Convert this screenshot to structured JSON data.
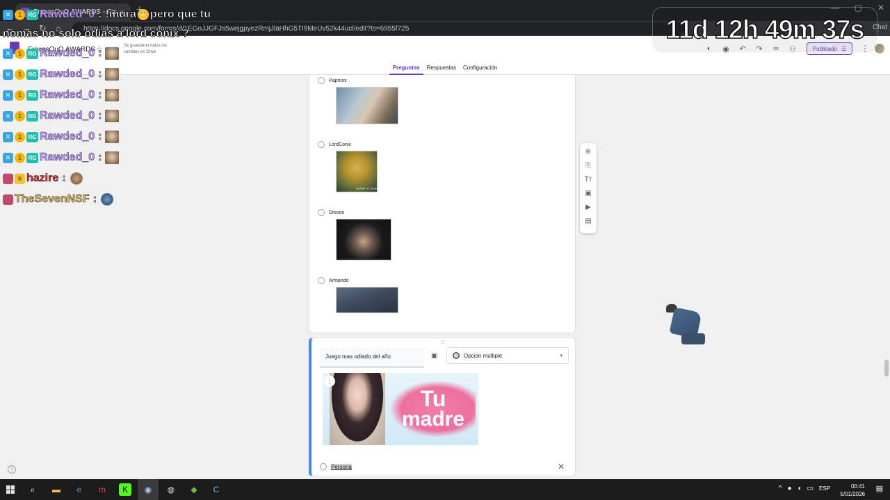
{
  "browser": {
    "tab_title": "FracasOuO AWARDS - Formularios",
    "tab_close": "×",
    "new_tab": "+",
    "url": "https://docs.google.com/forms/d/1EGoJJGFJs5wejgpyezRmjJlaHhG5TI9MeUv52k44ucl/edit?ts=6955f725",
    "chat_label": "Chat",
    "nav": {
      "back": "←",
      "forward": "→",
      "reload": "↻",
      "home": "⌂"
    },
    "window_controls": {
      "minimize": "—",
      "maximize": "▢",
      "close": "✕"
    }
  },
  "forms_header": {
    "doc_title": "FracasOuO AWARDS",
    "save_status": "Se guardaron todos los cambios en Drive",
    "publish_label": "Publicado",
    "icons": [
      "palette-icon",
      "preview-eye-icon",
      "undo-icon",
      "redo-icon",
      "link-icon",
      "add-collaborator-icon"
    ],
    "tabs": [
      {
        "label": "Preguntas",
        "active": true
      },
      {
        "label": "Respuestas",
        "active": false
      },
      {
        "label": "Configuración",
        "active": false
      }
    ]
  },
  "options": [
    {
      "label": "Papruxx"
    },
    {
      "label": "LordConix",
      "image_caption": "AGOST 17 •3:38"
    },
    {
      "label": "Drevox"
    },
    {
      "label": "Armando"
    }
  ],
  "question": {
    "title": "Juego mas odiado del año",
    "type_label": "Opción múltiple",
    "type_arrow": "▾",
    "image_line1": "Tu",
    "image_line2": "madre",
    "answer": "Persona",
    "remove": "✕",
    "image_menu": "⋮",
    "drag_handle": "⠿"
  },
  "side_toolbar": {
    "icons": [
      "add-question-icon",
      "import-questions-icon",
      "add-title-icon",
      "add-image-icon",
      "add-video-icon",
      "add-section-icon"
    ],
    "glyphs": [
      "⊕",
      "⎘",
      "Tт",
      "▣",
      "▶",
      "▤"
    ]
  },
  "stream_overlay": {
    "chat": [
      {
        "user": "Rawded_0",
        "message": "!mura",
        "message_tail": "pero que tu",
        "continuation": "nomas no solo odias a lord conix ?",
        "emote": "face-emote"
      },
      {
        "user": "Rawded_0",
        "message": "",
        "emote": "dog-emote"
      },
      {
        "user": "Rawded_0",
        "message": "",
        "emote": "dog-emote"
      },
      {
        "user": "Rawded_0",
        "message": "",
        "emote": "dog-emote"
      },
      {
        "user": "Rawded_0",
        "message": "",
        "emote": "dog-emote"
      },
      {
        "user": "Rawded_0",
        "message": "",
        "emote": "dog-emote"
      },
      {
        "user": "Rawded_0",
        "message": "",
        "emote": "dog-emote"
      },
      {
        "user": "hazire",
        "message": "",
        "emote": "pet-emote"
      },
      {
        "user": "TheSevenNSF",
        "message": "",
        "emote": "figure-emote"
      }
    ],
    "separator": ":",
    "timer": "11d 12h 49m 37s",
    "badge_coin": "1",
    "badge_rg": "RG",
    "badge_x": "✕"
  },
  "taskbar": {
    "icons": [
      "search-icon",
      "file-explorer-icon",
      "edge-icon",
      "app-m-icon",
      "kick-icon",
      "chrome-icon",
      "obs-icon",
      "minecraft-icon",
      "c-app-icon"
    ],
    "glyphs": [
      "⌕",
      "▬",
      "e",
      "m",
      "K",
      "◉",
      "◍",
      "◆",
      "C"
    ],
    "tray": {
      "chevron": "^",
      "mic": "🎙",
      "volume": "🔊",
      "network": "▭",
      "language": "ESP"
    },
    "time": "00:41",
    "date": "5/01/2026",
    "notification": "▤"
  }
}
